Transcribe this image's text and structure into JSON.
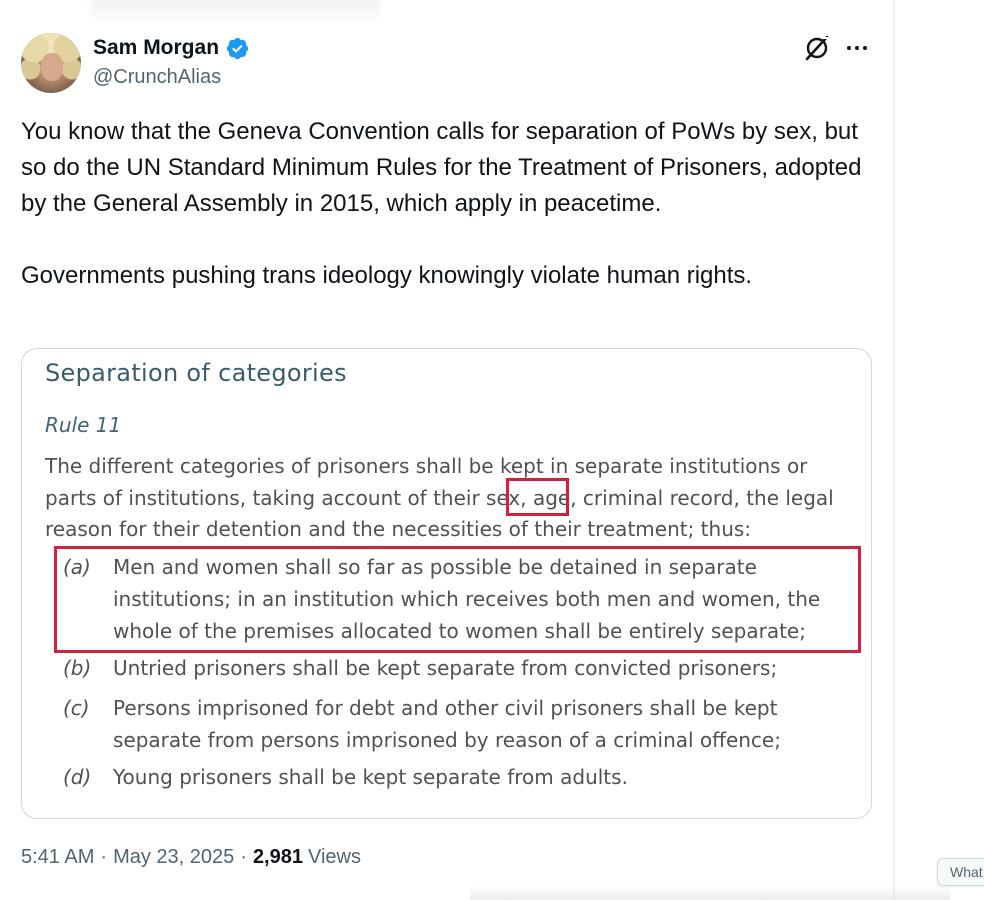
{
  "author": {
    "name": "Sam Morgan",
    "handle": "@CrunchAlias",
    "verified": true
  },
  "icons": {
    "verified": "verified-badge-icon",
    "grok": "grok-icon",
    "more": "more-options-icon"
  },
  "colors": {
    "verified": "#1d9bf0",
    "highlight_box": "#d51f3c",
    "doc_heading": "#3a5c6e"
  },
  "tweet": {
    "text": "You know that the Geneva Convention calls for separation of PoWs by sex, but so do the UN Standard Minimum Rules for the Treatment of Prisoners, adopted by the General Assembly in 2015, which apply in peacetime.\n\nGovernments pushing trans ideology knowingly violate human rights."
  },
  "media": {
    "heading": "Separation of categories",
    "rule": "Rule 11",
    "intro": "The different categories of prisoners shall be kept in separate institutions or parts of institutions, taking account of their sex, age, criminal record, the legal reason for their detention and the necessities of their treatment; thus:",
    "items": [
      {
        "label": "(a)",
        "text": "Men and women shall so far as possible be detained in separate institutions; in an institution which receives both men and women, the whole of the premises allocated to women shall be entirely separate;"
      },
      {
        "label": "(b)",
        "text": "Untried prisoners shall be kept separate from convicted prisoners;"
      },
      {
        "label": "(c)",
        "text": "Persons imprisoned for debt and other civil prisoners shall be kept separate from persons imprisoned by reason of a criminal offence;"
      },
      {
        "label": "(d)",
        "text": "Young prisoners shall be kept separate from adults."
      }
    ]
  },
  "meta": {
    "time": "5:41 AM",
    "date": "May 23, 2025",
    "views_count": "2,981",
    "views_label": "Views"
  },
  "translate_chip": {
    "label": "What"
  }
}
